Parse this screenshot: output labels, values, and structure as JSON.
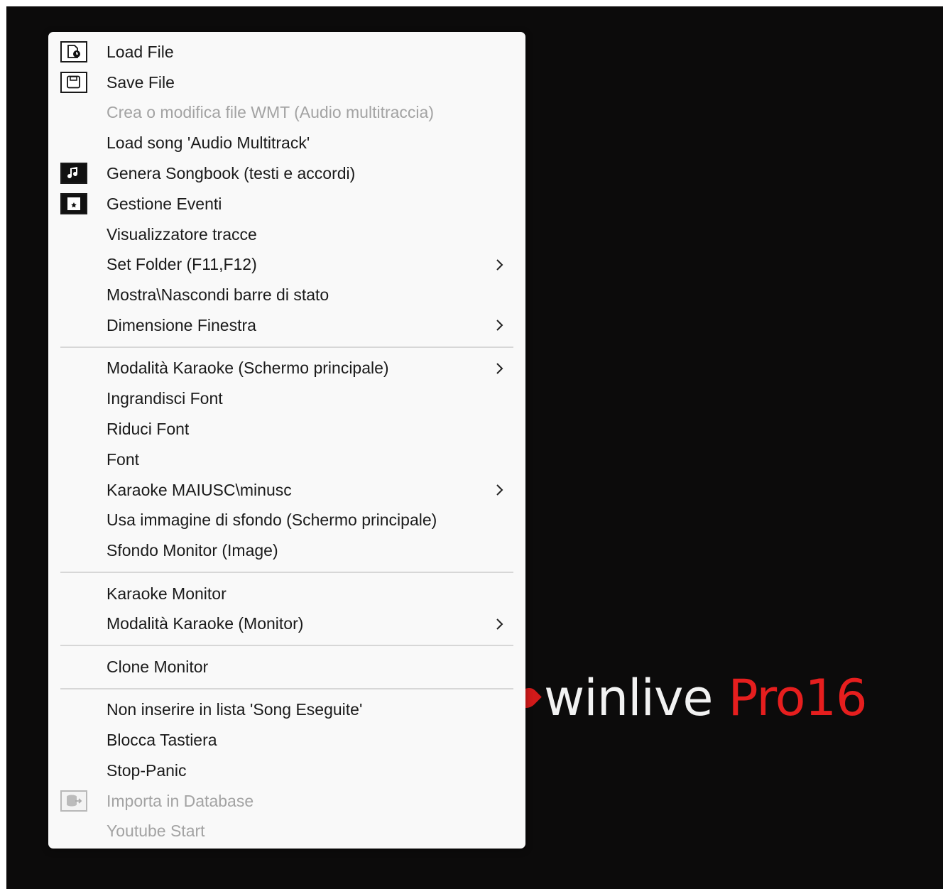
{
  "logo": {
    "name": "winlive",
    "edition": "Pro16"
  },
  "menu": {
    "items": [
      {
        "label": "Load File",
        "icon": "load-file-icon",
        "enabled": true
      },
      {
        "label": "Save File",
        "icon": "save-file-icon",
        "enabled": true
      },
      {
        "label": "Crea o modifica file WMT (Audio multitraccia)",
        "enabled": false
      },
      {
        "label": "Load song 'Audio Multitrack'",
        "enabled": true
      },
      {
        "label": "Genera Songbook (testi e accordi)",
        "icon": "songbook-icon",
        "enabled": true
      },
      {
        "label": "Gestione Eventi",
        "icon": "events-calendar-icon",
        "enabled": true
      },
      {
        "label": "Visualizzatore tracce",
        "enabled": true
      },
      {
        "label": "Set Folder (F11,F12)",
        "enabled": true,
        "submenu": true
      },
      {
        "label": "Mostra\\Nascondi barre di stato",
        "enabled": true
      },
      {
        "label": "Dimensione Finestra",
        "enabled": true,
        "submenu": true
      },
      {
        "separator": true
      },
      {
        "label": "Modalità Karaoke (Schermo principale)",
        "enabled": true,
        "submenu": true
      },
      {
        "label": "Ingrandisci Font",
        "enabled": true
      },
      {
        "label": "Riduci Font",
        "enabled": true
      },
      {
        "label": "Font",
        "enabled": true
      },
      {
        "label": "Karaoke MAIUSC\\minusc",
        "enabled": true,
        "submenu": true
      },
      {
        "label": "Usa immagine di sfondo (Schermo principale)",
        "enabled": true
      },
      {
        "label": "Sfondo Monitor (Image)",
        "enabled": true
      },
      {
        "separator": true
      },
      {
        "label": "Karaoke Monitor",
        "enabled": true
      },
      {
        "label": "Modalità Karaoke (Monitor)",
        "enabled": true,
        "submenu": true
      },
      {
        "separator": true
      },
      {
        "label": "Clone Monitor",
        "enabled": true
      },
      {
        "separator": true
      },
      {
        "label": "Non inserire in lista 'Song Eseguite'",
        "enabled": true
      },
      {
        "label": "Blocca Tastiera",
        "enabled": true
      },
      {
        "label": "Stop-Panic",
        "enabled": true
      },
      {
        "label": "Importa in Database",
        "icon": "database-import-icon",
        "enabled": false
      },
      {
        "label": "Youtube Start",
        "enabled": false
      }
    ]
  }
}
